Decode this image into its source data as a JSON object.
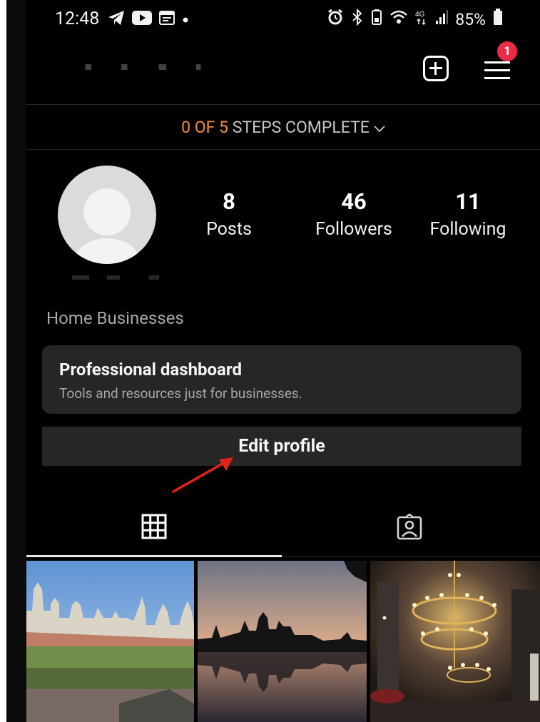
{
  "status_bar": {
    "time": "12:48",
    "battery_text": "85%"
  },
  "header": {
    "notification_count": "1"
  },
  "steps": {
    "current": "0",
    "of_label": "OF",
    "total": "5",
    "suffix": "STEPS COMPLETE"
  },
  "stats": {
    "posts_count": "8",
    "posts_label": "Posts",
    "followers_count": "46",
    "followers_label": "Followers",
    "following_count": "11",
    "following_label": "Following"
  },
  "bio": {
    "category": "Home Businesses"
  },
  "dashboard": {
    "title": "Professional dashboard",
    "subtitle": "Tools and resources just for businesses."
  },
  "edit_profile": {
    "label": "Edit profile"
  },
  "tabs": [
    {
      "icon": "grid-icon",
      "active": true
    },
    {
      "icon": "tagged-icon",
      "active": false
    }
  ],
  "colors": {
    "background": "#000000",
    "accent": "#f68b3a",
    "badge": "#ed2a48",
    "card": "#262626",
    "annotation": "#e2231a"
  }
}
